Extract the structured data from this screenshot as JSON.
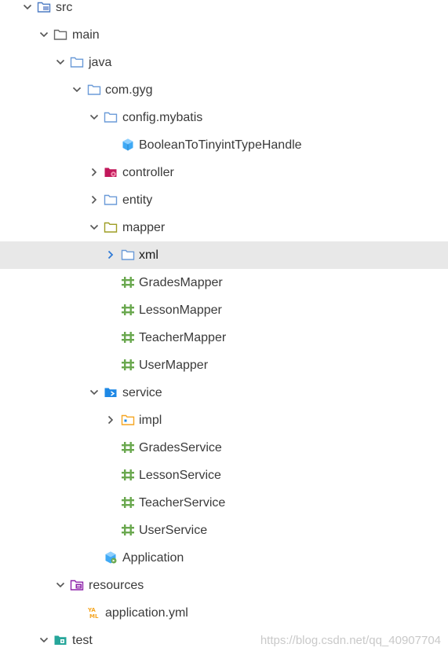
{
  "tree": {
    "items": [
      {
        "name": "src",
        "icon": "source-folder-icon",
        "expanded": true
      },
      {
        "name": "main",
        "icon": "folder-icon",
        "expanded": true
      },
      {
        "name": "java",
        "icon": "package-folder-icon",
        "expanded": true
      },
      {
        "name": "com.gyg",
        "icon": "package-folder-icon",
        "expanded": true
      },
      {
        "name": "config.mybatis",
        "icon": "package-folder-icon",
        "expanded": true
      },
      {
        "name": "BooleanToTinyintTypeHandle",
        "icon": "class-file-icon"
      },
      {
        "name": "controller",
        "icon": "controller-folder-icon",
        "expanded": false
      },
      {
        "name": "entity",
        "icon": "package-folder-icon",
        "expanded": false
      },
      {
        "name": "mapper",
        "icon": "mapper-folder-icon",
        "expanded": true
      },
      {
        "name": "xml",
        "icon": "package-folder-icon",
        "expanded": false,
        "selected": true
      },
      {
        "name": "GradesMapper",
        "icon": "interface-file-icon"
      },
      {
        "name": "LessonMapper",
        "icon": "interface-file-icon"
      },
      {
        "name": "TeacherMapper",
        "icon": "interface-file-icon"
      },
      {
        "name": "UserMapper",
        "icon": "interface-file-icon"
      },
      {
        "name": "service",
        "icon": "service-folder-icon",
        "expanded": true
      },
      {
        "name": "impl",
        "icon": "impl-folder-icon",
        "expanded": false
      },
      {
        "name": "GradesService",
        "icon": "interface-file-icon"
      },
      {
        "name": "LessonService",
        "icon": "interface-file-icon"
      },
      {
        "name": "TeacherService",
        "icon": "interface-file-icon"
      },
      {
        "name": "UserService",
        "icon": "interface-file-icon"
      },
      {
        "name": "Application",
        "icon": "application-class-icon"
      },
      {
        "name": "resources",
        "icon": "resources-folder-icon",
        "expanded": true
      },
      {
        "name": "application.yml",
        "icon": "yaml-file-icon"
      },
      {
        "name": "test",
        "icon": "test-folder-icon",
        "expanded": true
      }
    ]
  },
  "watermark": "https://blog.csdn.net/qq_40907704",
  "colors": {
    "selected_bg": "#e8e8e8",
    "folder_blue": "#6b9bd8",
    "interface_green": "#6aa84f",
    "chevron": "#555555",
    "chevron_selected": "#2f7ad6",
    "text": "#3a3a3a"
  }
}
